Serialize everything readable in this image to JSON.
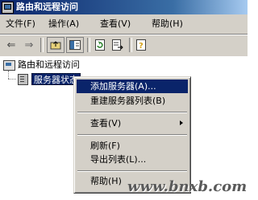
{
  "window": {
    "title": "路由和远程访问"
  },
  "menubar": {
    "items": [
      {
        "label": "文件(F)"
      },
      {
        "label": "操作(A)"
      },
      {
        "label": "查看(V)"
      },
      {
        "label": "帮助(H)"
      }
    ]
  },
  "toolbar": {
    "buttons": [
      "back-arrow-icon",
      "forward-arrow-icon",
      "up-folder-icon",
      "show-hide-tree-icon",
      "refresh-icon",
      "export-list-icon",
      "help-icon"
    ]
  },
  "tree": {
    "root_label": "路由和远程访问",
    "child_label": "服务器状态"
  },
  "context_menu": {
    "items": [
      {
        "label": "添加服务器(A)..."
      },
      {
        "label": "重建服务器列表(B)"
      },
      {
        "label": "查看(V)"
      },
      {
        "label": "刷新(F)"
      },
      {
        "label": "导出列表(L)..."
      },
      {
        "label": "帮助(H)"
      }
    ]
  },
  "watermark": "www.bnxb.com"
}
